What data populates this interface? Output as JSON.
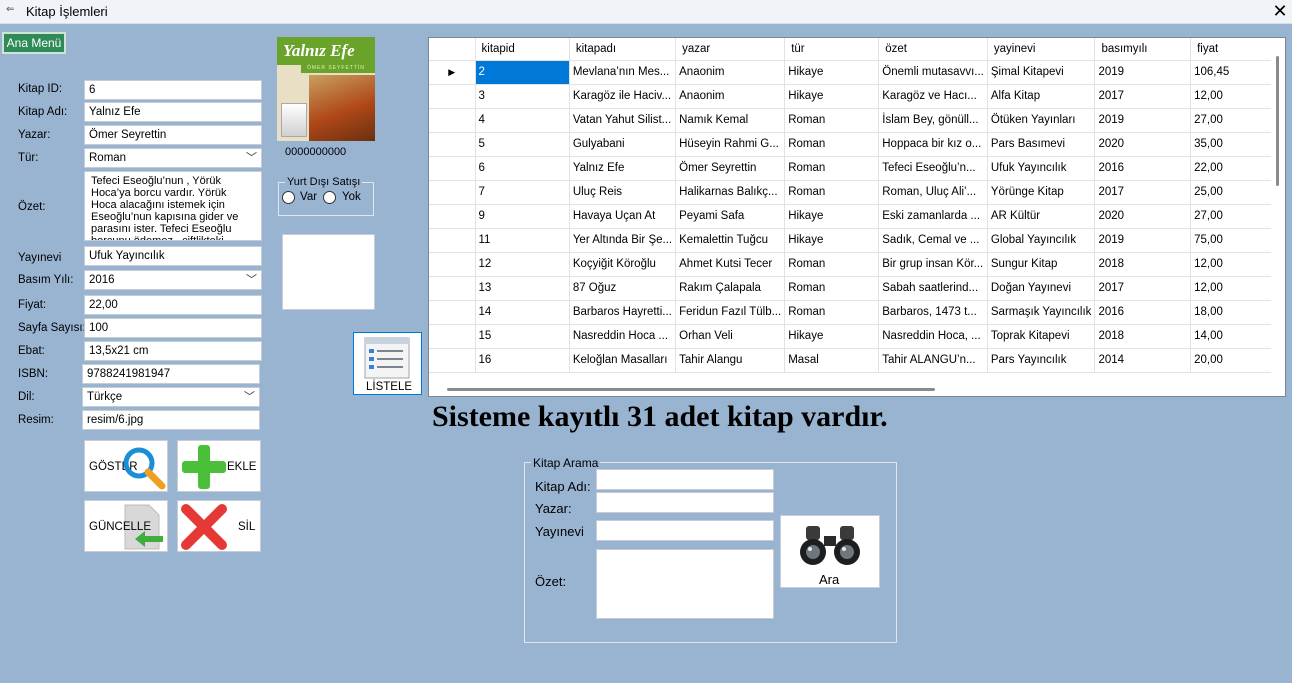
{
  "window": {
    "title": "Kitap İşlemleri",
    "close_glyph": "✕"
  },
  "main_menu_button": "Ana Menü",
  "form": {
    "labels": {
      "kitap_id": "Kitap ID:",
      "kitap_adi": "Kitap Adı:",
      "yazar": "Yazar:",
      "tur": "Tür:",
      "ozet": "Özet:",
      "yayinevi": "Yayınevi",
      "basim_yili": "Basım Yılı:",
      "fiyat": "Fiyat:",
      "sayfa_sayisi": "Sayfa Sayısı:",
      "ebat": "Ebat:",
      "isbn": "ISBN:",
      "dil": "Dil:",
      "resim": "Resim:"
    },
    "values": {
      "kitap_id": "6",
      "kitap_adi": "Yalnız Efe",
      "yazar": "Ömer Seyrettin",
      "tur": "Roman",
      "ozet": "Tefeci Eseoğlu’nun , Yörük Hoca’ya borcu vardır. Yörük Hoca alacağını istemek için Eseoğlu’nun kapısına gider ve parasını ister. Tefeci Eseoğlu borcunu ödemez , çiftlikteki",
      "yayinevi": "Ufuk Yayıncılık",
      "basim_yili": "2016",
      "fiyat": "22,00",
      "sayfa_sayisi": "100",
      "ebat": "13,5x21 cm",
      "isbn": "9788241981947",
      "dil": "Türkçe",
      "resim": "resim/6.jpg"
    }
  },
  "cover": {
    "title": "Yalnız Efe",
    "author_strip": "ÖMER SEYFETTİN",
    "barcode": "0000000000"
  },
  "yurt_disi": {
    "legend": "Yurt Dışı Satışı",
    "var": "Var",
    "yok": "Yok"
  },
  "buttons": {
    "goster": "GÖSTER",
    "ekle": "EKLE",
    "guncelle": "GÜNCELLE",
    "sil": "SİL",
    "listele": "LİSTELE",
    "ara": "Ara"
  },
  "grid": {
    "columns": [
      "kitapid",
      "kitapadı",
      "yazar",
      "tür",
      "özet",
      "yayinevi",
      "basımyılı",
      "fiyat"
    ],
    "rows": [
      [
        "2",
        "Mevlana’nın Mes...",
        "Anaonim",
        "Hikaye",
        "Önemli mutasavvı...",
        "Şimal Kitapevi",
        "2019",
        "106,45"
      ],
      [
        "3",
        "Karagöz ile Haciv...",
        "Anaonim",
        "Hikaye",
        "Karagöz ve Hacı...",
        "Alfa Kitap",
        "2017",
        "12,00"
      ],
      [
        "4",
        "Vatan Yahut Silist...",
        "Namık Kemal",
        "Roman",
        "İslam Bey, gönüll...",
        "Ötüken Yayınları",
        "2019",
        "27,00"
      ],
      [
        "5",
        "Gulyabani",
        "Hüseyin Rahmi G...",
        "Roman",
        "Hoppaca bir kız o...",
        "Pars Basımevi",
        "2020",
        "35,00"
      ],
      [
        "6",
        "Yalnız Efe",
        "Ömer Seyrettin",
        "Roman",
        "Tefeci Eseoğlu’n...",
        "Ufuk Yayıncılık",
        "2016",
        "22,00"
      ],
      [
        "7",
        "Uluç Reis",
        "Halikarnas Balıkç...",
        "Roman",
        "Roman, Uluç Ali’...",
        "Yörünge Kitap",
        "2017",
        "25,00"
      ],
      [
        "9",
        "Havaya Uçan At",
        "Peyami Safa",
        "Hikaye",
        "Eski zamanlarda ...",
        "AR Kültür",
        "2020",
        "27,00"
      ],
      [
        "11",
        "Yer Altında Bir Şe...",
        "Kemalettin Tuğcu",
        "Hikaye",
        "Sadık, Cemal ve ...",
        "Global Yayıncılık",
        "2019",
        "75,00"
      ],
      [
        "12",
        "Koçyiğit Köroğlu",
        "Ahmet Kutsi Tecer",
        "Roman",
        "Bir grup insan Kör...",
        "Sungur Kitap",
        "2018",
        "12,00"
      ],
      [
        "13",
        "87 Oğuz",
        "Rakım Çalapala",
        "Roman",
        "Sabah saatlerind...",
        "Doğan Yayınevi",
        "2017",
        "12,00"
      ],
      [
        "14",
        "Barbaros Hayretti...",
        "Feridun Fazıl Tülb...",
        "Roman",
        "Barbaros, 1473 t...",
        "Sarmaşık Yayıncılık",
        "2016",
        "18,00"
      ],
      [
        "15",
        "Nasreddin Hoca ...",
        "Orhan Veli",
        "Hikaye",
        "Nasreddin Hoca, ...",
        "Toprak Kitapevi",
        "2018",
        "14,00"
      ],
      [
        "16",
        "Keloğlan Masalları",
        "Tahir Alangu",
        "Masal",
        "Tahir ALANGU’n...",
        "Pars Yayıncılık",
        "2014",
        "20,00"
      ]
    ],
    "selected_marker": "▶"
  },
  "count_text": "Sisteme kayıtlı 31 adet kitap vardır.",
  "search": {
    "legend": "Kitap Arama",
    "labels": {
      "kitap_adi": "Kitap Adı:",
      "yazar": "Yazar:",
      "yayinevi": "Yayınevi",
      "ozet": "Özet:"
    }
  }
}
